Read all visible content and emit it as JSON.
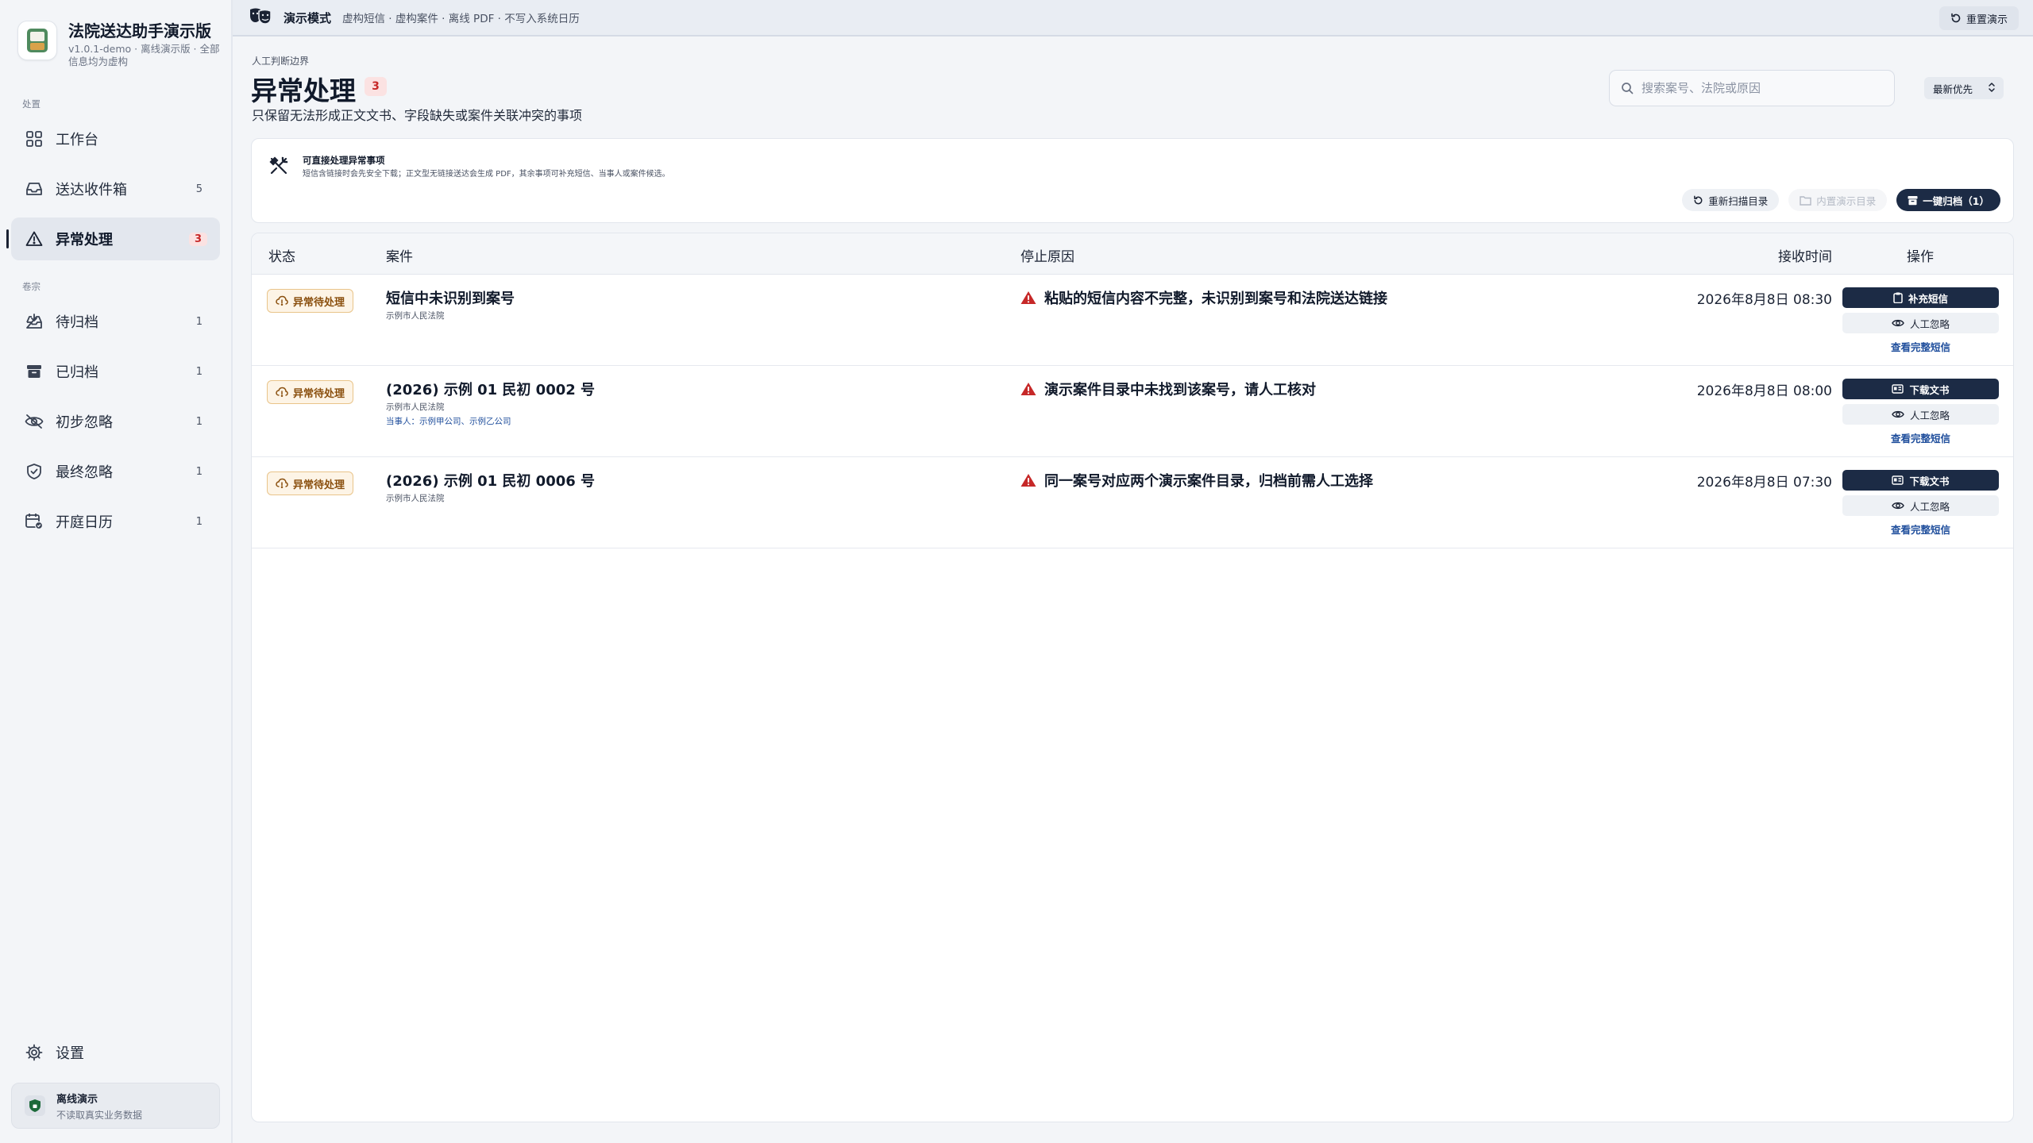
{
  "app": {
    "title": "法院送达助手演示版",
    "subtitle": "v1.0.1-demo · 离线演示版 · 全部信息均为虚构"
  },
  "colors": {
    "accent_dark": "#1c2b45",
    "danger": "#c62828",
    "warning_bg": "#fdf4e6",
    "link": "#1f4e9c"
  },
  "sidebar": {
    "section_handle": "处置",
    "section_archive": "卷宗",
    "items": [
      {
        "label": "工作台",
        "icon": "grid-icon",
        "count": ""
      },
      {
        "label": "送达收件箱",
        "icon": "inbox-icon",
        "count": "5"
      },
      {
        "label": "异常处理",
        "icon": "warning-icon",
        "count": "3",
        "active": true
      },
      {
        "label": "待归档",
        "icon": "tray-icon",
        "count": "1"
      },
      {
        "label": "已归档",
        "icon": "archive-icon",
        "count": "1"
      },
      {
        "label": "初步忽略",
        "icon": "eye-off-icon",
        "count": "1"
      },
      {
        "label": "最终忽略",
        "icon": "shield-check-icon",
        "count": "1"
      },
      {
        "label": "开庭日历",
        "icon": "calendar-icon",
        "count": "1"
      }
    ],
    "settings": "设置",
    "offline": {
      "title": "离线演示",
      "subtitle": "不读取真实业务数据"
    }
  },
  "topbar": {
    "mode": "演示模式",
    "description": "虚构短信 · 虚构案件 · 离线 PDF · 不写入系统日历",
    "reset": "重置演示"
  },
  "header": {
    "eyebrow": "人工判断边界",
    "title": "异常处理",
    "count": "3",
    "subtitle": "只保留无法形成正文文书、字段缺失或案件关联冲突的事项",
    "search_placeholder": "搜索案号、法院或原因",
    "sort": "最新优先"
  },
  "info": {
    "title": "可直接处理异常事项",
    "description": "短信含链接时会先安全下载；正文型无链接送达会生成 PDF，其余事项可补充短信、当事人或案件候选。",
    "rescan": "重新扫描目录",
    "builtin": "内置演示目录",
    "archive_all": "一键归档（1）"
  },
  "table": {
    "headers": {
      "status": "状态",
      "case": "案件",
      "reason": "停止原因",
      "time": "接收时间",
      "actions": "操作"
    },
    "rows": [
      {
        "status": "异常待处理",
        "case": "短信中未识别到案号",
        "court": "示例市人民法院",
        "party": "",
        "reason": "粘贴的短信内容不完整，未识别到案号和法院送达链接",
        "time": "2026年8月8日 08:30",
        "primary": "补充短信",
        "ignore": "人工忽略",
        "link": "查看完整短信"
      },
      {
        "status": "异常待处理",
        "case": "(2026) 示例 01 民初 0002 号",
        "court": "示例市人民法院",
        "party": "当事人：示例甲公司、示例乙公司",
        "reason": "演示案件目录中未找到该案号，请人工核对",
        "time": "2026年8月8日 08:00",
        "primary": "下载文书",
        "ignore": "人工忽略",
        "link": "查看完整短信"
      },
      {
        "status": "异常待处理",
        "case": "(2026) 示例 01 民初 0006 号",
        "court": "示例市人民法院",
        "party": "",
        "reason": "同一案号对应两个演示案件目录，归档前需人工选择",
        "time": "2026年8月8日 07:30",
        "primary": "下载文书",
        "ignore": "人工忽略",
        "link": "查看完整短信"
      }
    ]
  }
}
